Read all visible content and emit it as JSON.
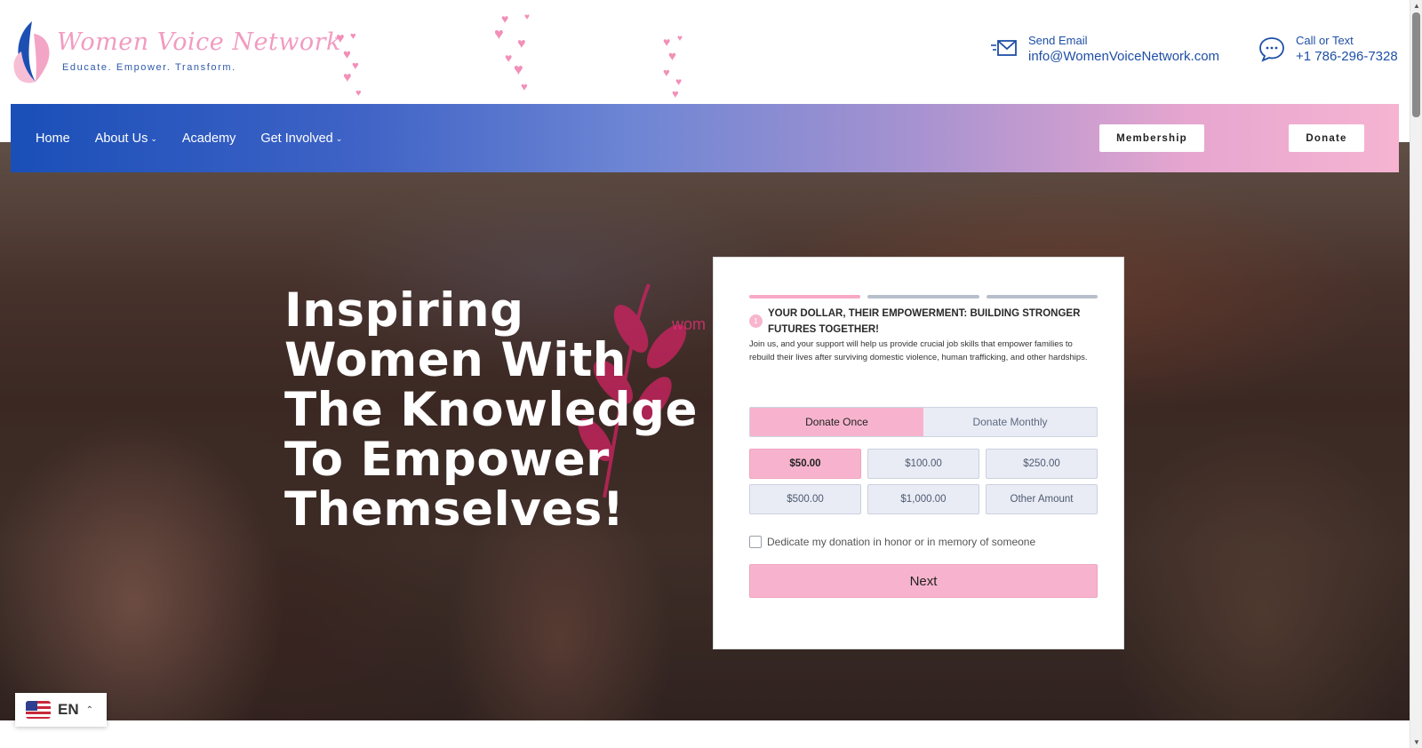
{
  "header": {
    "logo_name": "Women Voice Network",
    "logo_tagline": "Educate. Empower. Transform.",
    "email_label": "Send Email",
    "email_value": "info@WomenVoiceNetwork.com",
    "phone_label": "Call or Text",
    "phone_value": "+1 786-296-7328"
  },
  "nav": {
    "items": [
      {
        "label": "Home",
        "dropdown": false
      },
      {
        "label": "About Us",
        "dropdown": true
      },
      {
        "label": "Academy",
        "dropdown": false
      },
      {
        "label": "Get Involved",
        "dropdown": true
      }
    ],
    "membership_label": "Membership",
    "donate_label": "Donate"
  },
  "hero": {
    "title": "Inspiring Women With The Knowledge To Empower Themselves!",
    "background_text": "wom"
  },
  "donation_form": {
    "step_number": "1",
    "total_steps_active": 1,
    "heading": "YOUR DOLLAR, THEIR EMPOWERMENT: BUILDING STRONGER FUTURES TOGETHER!",
    "description": "Join us, and your support will help us provide crucial job skills that empower families to rebuild their lives after surviving domestic violence, human trafficking, and other hardships.",
    "frequency": [
      {
        "label": "Donate Once",
        "selected": true
      },
      {
        "label": "Donate Monthly",
        "selected": false
      }
    ],
    "amounts": [
      {
        "label": "$50.00",
        "selected": true
      },
      {
        "label": "$100.00",
        "selected": false
      },
      {
        "label": "$250.00",
        "selected": false
      },
      {
        "label": "$500.00",
        "selected": false
      },
      {
        "label": "$1,000.00",
        "selected": false
      },
      {
        "label": "Other Amount",
        "selected": false
      }
    ],
    "dedicate_label": "Dedicate my donation in honor or in memory of someone",
    "dedicate_checked": false,
    "next_label": "Next"
  },
  "language": {
    "code": "EN"
  },
  "colors": {
    "brand_blue": "#1f4fa5",
    "brand_pink": "#f7b3cd"
  },
  "icons": {
    "email": "envelope-icon",
    "phone": "chat-bubble-icon",
    "logo": "butterfly-icon",
    "flag": "us-flag-icon"
  }
}
